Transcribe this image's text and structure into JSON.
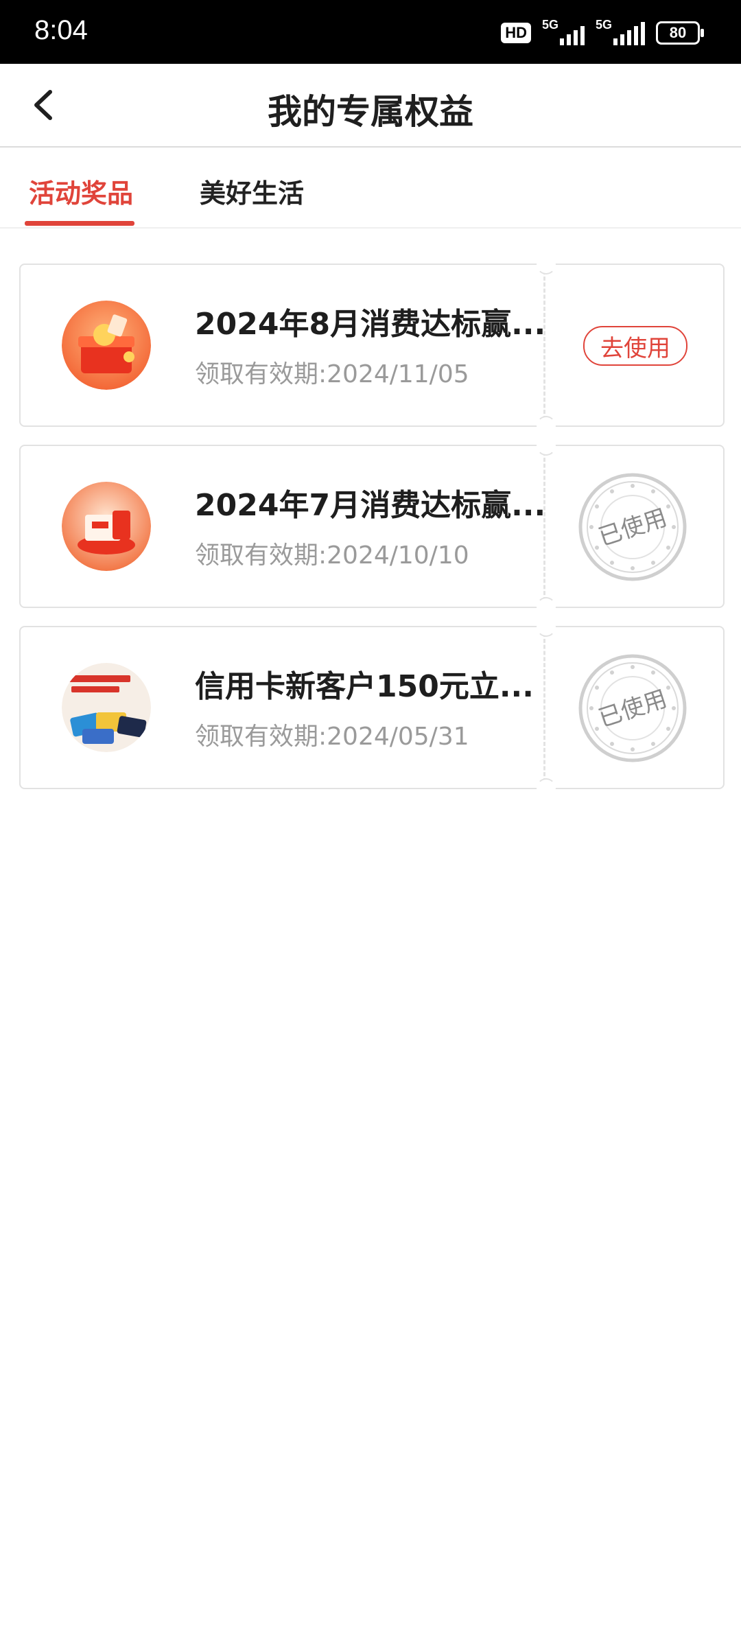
{
  "status_bar": {
    "time": "8:04",
    "hd_label": "HD",
    "network_1": "5G",
    "network_2": "5G",
    "battery": "80"
  },
  "header": {
    "title": "我的专属权益",
    "back_icon": "chevron-left-icon"
  },
  "tabs": [
    {
      "label": "活动奖品",
      "active": true
    },
    {
      "label": "美好生活",
      "active": false
    }
  ],
  "colors": {
    "accent": "#e0443a",
    "stamp": "#c8c8c8"
  },
  "rewards": [
    {
      "title": "2024年8月消费达标赢...",
      "validity": "领取有效期:2024/11/05",
      "action_label": "去使用",
      "status": "available"
    },
    {
      "title": "2024年7月消费达标赢...",
      "validity": "领取有效期:2024/10/10",
      "stamp_label": "已使用",
      "status": "used"
    },
    {
      "title": "信用卡新客户150元立...",
      "validity": "领取有效期:2024/05/31",
      "stamp_label": "已使用",
      "status": "used"
    }
  ]
}
